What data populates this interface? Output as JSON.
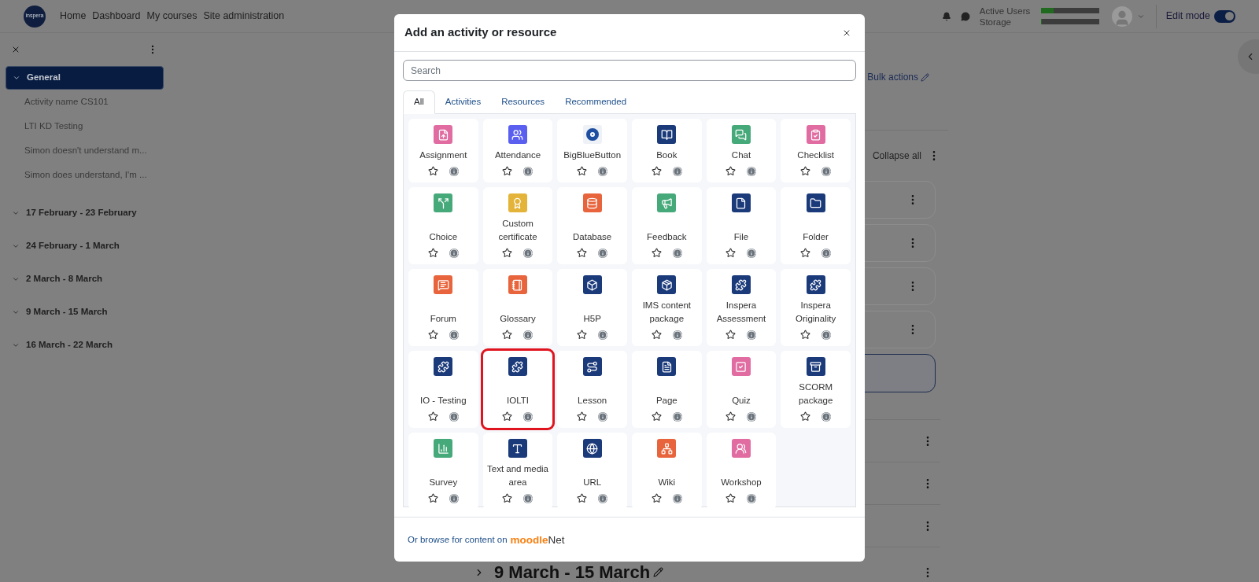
{
  "top_nav": {
    "logo": "inspera",
    "links": [
      "Home",
      "Dashboard",
      "My courses",
      "Site administration"
    ],
    "usage": [
      {
        "label": "Active Users",
        "level": 0.22
      },
      {
        "label": "Storage",
        "level": 0.01
      }
    ],
    "edit_mode": {
      "label": "Edit mode",
      "on": true
    }
  },
  "sidebar": {
    "sections": [
      {
        "title": "General",
        "selected": true,
        "items": [
          "Activity name CS101",
          "LTI KD Testing",
          "Simon doesn't understand m...",
          "Simon does understand, I'm ..."
        ]
      },
      {
        "title": "17 February - 23 February",
        "selected": false
      },
      {
        "title": "24 February - 1 March",
        "selected": false
      },
      {
        "title": "2 March - 8 March",
        "selected": false
      },
      {
        "title": "9 March - 15 March",
        "selected": false
      },
      {
        "title": "16 March - 22 March",
        "selected": false
      }
    ]
  },
  "course": {
    "bulk_actions": "Bulk actions",
    "collapse_all": "Collapse all",
    "section_heading": "9 March - 15 March"
  },
  "modal": {
    "title": "Add an activity or resource",
    "search": {
      "placeholder": "Search"
    },
    "tabs": [
      {
        "label": "All",
        "selected": true
      },
      {
        "label": "Activities",
        "selected": false
      },
      {
        "label": "Resources",
        "selected": false
      },
      {
        "label": "Recommended",
        "selected": false
      }
    ],
    "items": [
      {
        "name": "Assignment",
        "color": "#e06ca1",
        "starred": false,
        "highlighted": false
      },
      {
        "name": "Attendance",
        "color": "#5b5ff0",
        "starred": false,
        "highlighted": false
      },
      {
        "name": "BigBlueButton",
        "color": "#1d4ea0",
        "starred": false,
        "highlighted": false
      },
      {
        "name": "Book",
        "color": "#1b3a7a",
        "starred": false,
        "highlighted": false
      },
      {
        "name": "Chat",
        "color": "#46a97a",
        "starred": false,
        "highlighted": false
      },
      {
        "name": "Checklist",
        "color": "#e06ca1",
        "starred": false,
        "highlighted": false
      },
      {
        "name": "Choice",
        "color": "#46a97a",
        "starred": false,
        "highlighted": false
      },
      {
        "name": "Custom certificate",
        "color": "#e4b43a",
        "starred": false,
        "highlighted": false
      },
      {
        "name": "Database",
        "color": "#e8643c",
        "starred": false,
        "highlighted": false
      },
      {
        "name": "Feedback",
        "color": "#46a97a",
        "starred": false,
        "highlighted": false
      },
      {
        "name": "File",
        "color": "#1b3a7a",
        "starred": false,
        "highlighted": false
      },
      {
        "name": "Folder",
        "color": "#1b3a7a",
        "starred": false,
        "highlighted": false
      },
      {
        "name": "Forum",
        "color": "#e8643c",
        "starred": false,
        "highlighted": false
      },
      {
        "name": "Glossary",
        "color": "#e8643c",
        "starred": false,
        "highlighted": false
      },
      {
        "name": "H5P",
        "color": "#1b3a7a",
        "starred": false,
        "highlighted": false
      },
      {
        "name": "IMS content package",
        "color": "#1b3a7a",
        "starred": false,
        "highlighted": false
      },
      {
        "name": "Inspera Assessment",
        "color": "#1b3a7a",
        "starred": false,
        "highlighted": false
      },
      {
        "name": "Inspera Originality",
        "color": "#1b3a7a",
        "starred": false,
        "highlighted": false
      },
      {
        "name": "IO - Testing",
        "color": "#1b3a7a",
        "starred": false,
        "highlighted": false
      },
      {
        "name": "IOLTI",
        "color": "#1b3a7a",
        "starred": false,
        "highlighted": true
      },
      {
        "name": "Lesson",
        "color": "#1b3a7a",
        "starred": false,
        "highlighted": false
      },
      {
        "name": "Page",
        "color": "#1b3a7a",
        "starred": false,
        "highlighted": false
      },
      {
        "name": "Quiz",
        "color": "#e06ca1",
        "starred": false,
        "highlighted": false
      },
      {
        "name": "SCORM package",
        "color": "#1b3a7a",
        "starred": false,
        "highlighted": false
      },
      {
        "name": "Survey",
        "color": "#46a97a",
        "starred": false,
        "highlighted": false
      },
      {
        "name": "Text and media area",
        "color": "#1b3a7a",
        "starred": false,
        "highlighted": false
      },
      {
        "name": "URL",
        "color": "#1b3a7a",
        "starred": false,
        "highlighted": false
      },
      {
        "name": "Wiki",
        "color": "#e8643c",
        "starred": false,
        "highlighted": false
      },
      {
        "name": "Workshop",
        "color": "#e06ca1",
        "starred": false,
        "highlighted": false
      }
    ],
    "footer": {
      "text": "Or browse for content on",
      "brand": [
        "moodle",
        "Net"
      ]
    }
  }
}
